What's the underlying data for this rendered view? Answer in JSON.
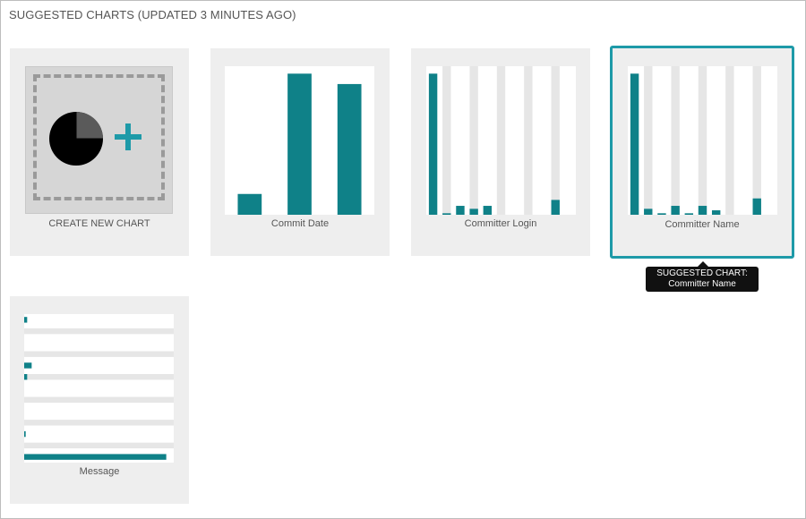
{
  "header": {
    "title": "SUGGESTED CHARTS (UPDATED 3 MINUTES AGO)"
  },
  "colors": {
    "accent": "#0f8188",
    "stripe": "#e6e6e6",
    "selected_border": "#1e9aa8"
  },
  "cards": [
    {
      "label": "CREATE NEW CHART",
      "icon": "pie-chart-plus-icon"
    },
    {
      "label": "Commit Date"
    },
    {
      "label": "Committer Login"
    },
    {
      "label": "Committer Name",
      "selected": true
    },
    {
      "label": "Message"
    }
  ],
  "tooltip": {
    "line1": "SUGGESTED CHART:",
    "line2": "Committer Name"
  },
  "chart_data": [
    {
      "type": "bar",
      "title": "Commit Date",
      "values": [
        0.14,
        0.95,
        0.88
      ],
      "ylim": [
        0,
        1
      ]
    },
    {
      "type": "bar",
      "title": "Committer Login",
      "values": [
        0.95,
        0.01,
        0.06,
        0.04,
        0.06,
        0,
        0,
        0,
        0,
        0.1,
        0
      ],
      "ylim": [
        0,
        1
      ]
    },
    {
      "type": "bar",
      "title": "Committer Name",
      "values": [
        0.95,
        0.04,
        0.01,
        0.06,
        0.01,
        0.06,
        0.03,
        0,
        0,
        0.11,
        0
      ],
      "ylim": [
        0,
        1
      ]
    },
    {
      "type": "bar",
      "orientation": "horizontal",
      "title": "Message",
      "values": [
        0.02,
        0,
        0,
        0,
        0.05,
        0.02,
        0,
        0,
        0,
        0,
        0.01,
        0,
        0.95
      ],
      "ylim": [
        0,
        1
      ]
    }
  ]
}
